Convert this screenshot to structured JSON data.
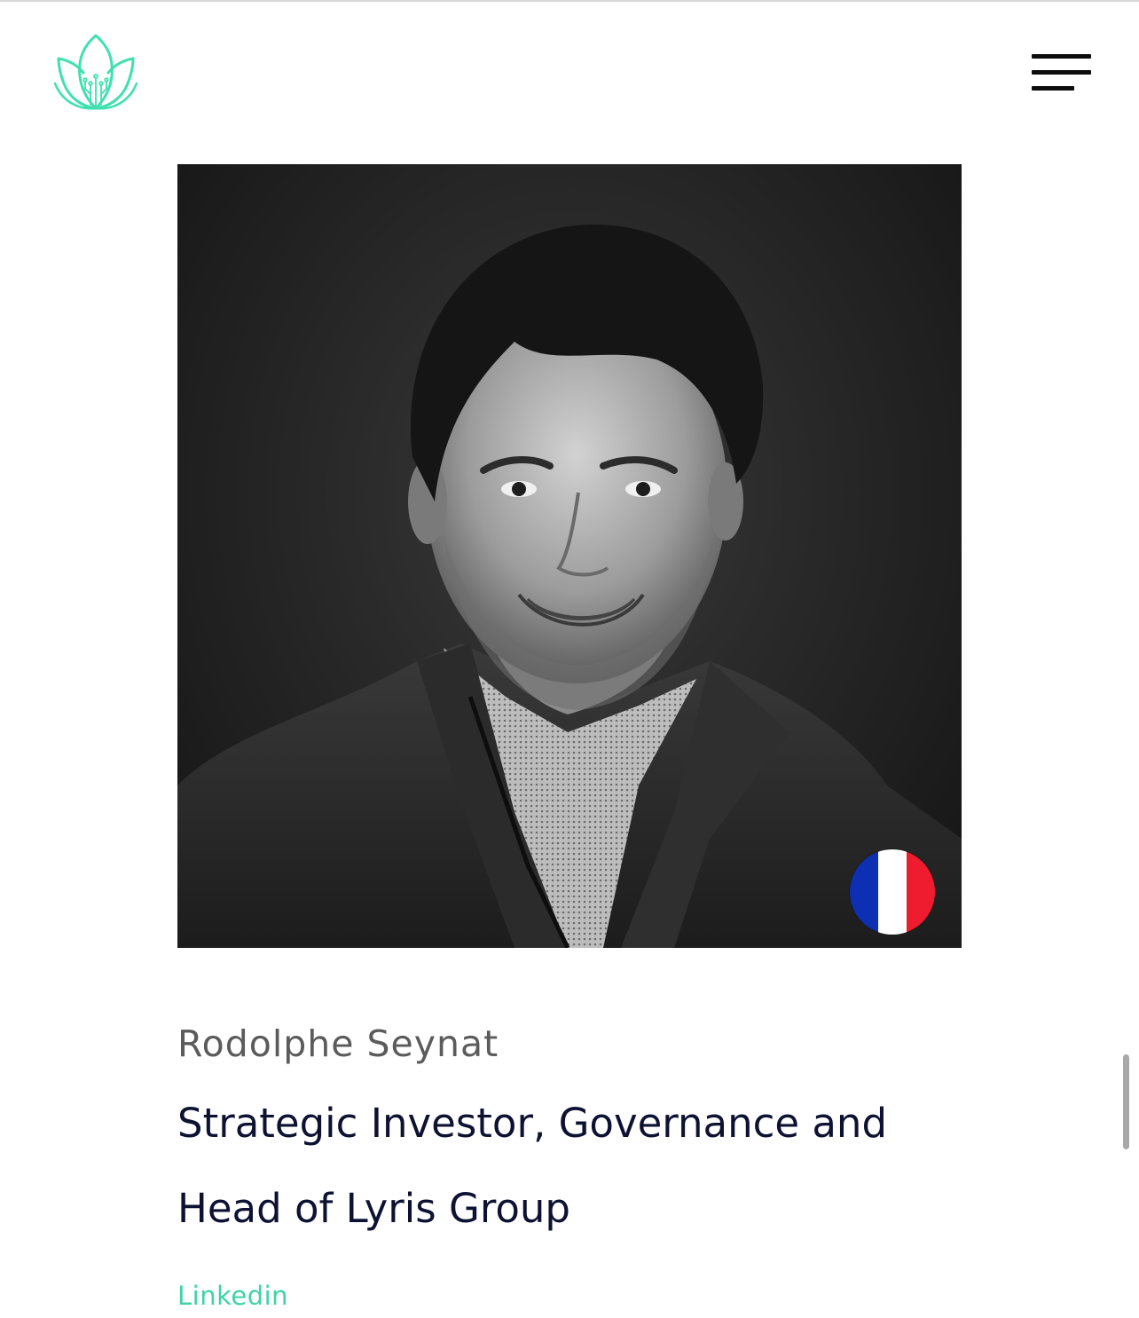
{
  "header": {
    "logo_icon": "lotus-circuit-logo",
    "menu_icon": "hamburger-menu-icon"
  },
  "profile": {
    "photo_icon": "portrait-photo",
    "flag_icon": "france-flag-icon",
    "flag_colors": [
      "#0c2fb3",
      "#ffffff",
      "#ef1b2e"
    ],
    "name": "Rodolphe Seynat",
    "role": "Strategic Investor, Governance and Head of Lyris Group",
    "link_label": "Linkedin"
  },
  "colors": {
    "accent": "#3fd3a6",
    "title": "#0e1232",
    "name": "#5b5b5b"
  }
}
